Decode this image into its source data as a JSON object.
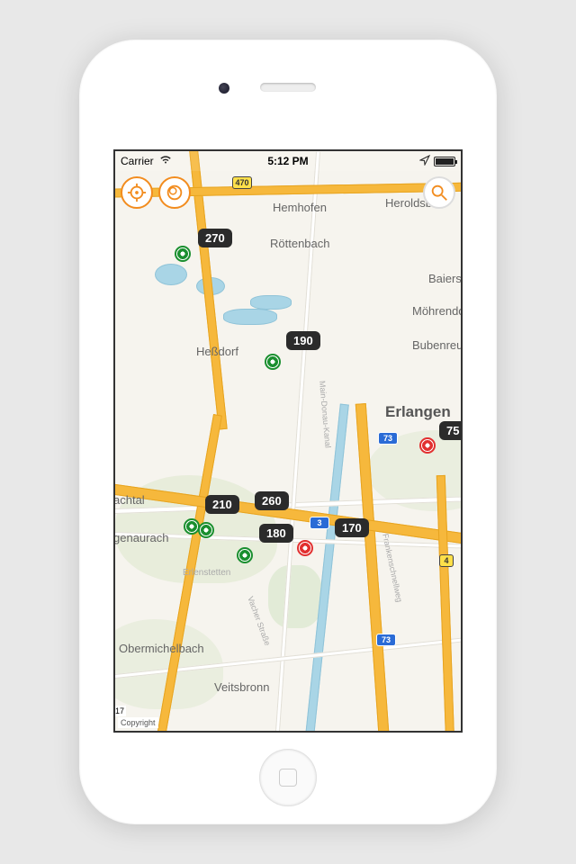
{
  "statusbar": {
    "carrier": "Carrier",
    "time": "5:12 PM"
  },
  "copyright": "Copyright",
  "cities": {
    "hemhofen": "Hemhofen",
    "heroldsb": "Heroldsb",
    "rottenbach": "Röttenbach",
    "baiers": "Baiers",
    "mohrendo": "Möhrendo",
    "hessdorf": "Heßdorf",
    "bubenreu": "Bubenreu",
    "erlangen": "Erlangen",
    "achtal": "achtal",
    "genaurach": "genaurach",
    "erlenstetten": "Erlenstetten",
    "vacherstr": "Vacher Straße",
    "obermichelbach": "Obermichelbach",
    "veitsbronn": "Veitsbronn",
    "frankenschnell": "Frankenschnellweg",
    "maindonau": "Main-Donau-Kanal"
  },
  "shields": {
    "b470": "470",
    "a73a": "73",
    "a73b": "73",
    "a3": "3",
    "y4": "4"
  },
  "markers": [
    {
      "id": "m1",
      "badge": "270"
    },
    {
      "id": "m2",
      "badge": "190"
    },
    {
      "id": "m3",
      "badge": "210"
    },
    {
      "id": "m4",
      "badge": "260"
    },
    {
      "id": "m5",
      "badge": "180"
    },
    {
      "id": "m6",
      "badge": "170"
    },
    {
      "id": "m7",
      "badge": "75"
    }
  ],
  "n7": "17"
}
